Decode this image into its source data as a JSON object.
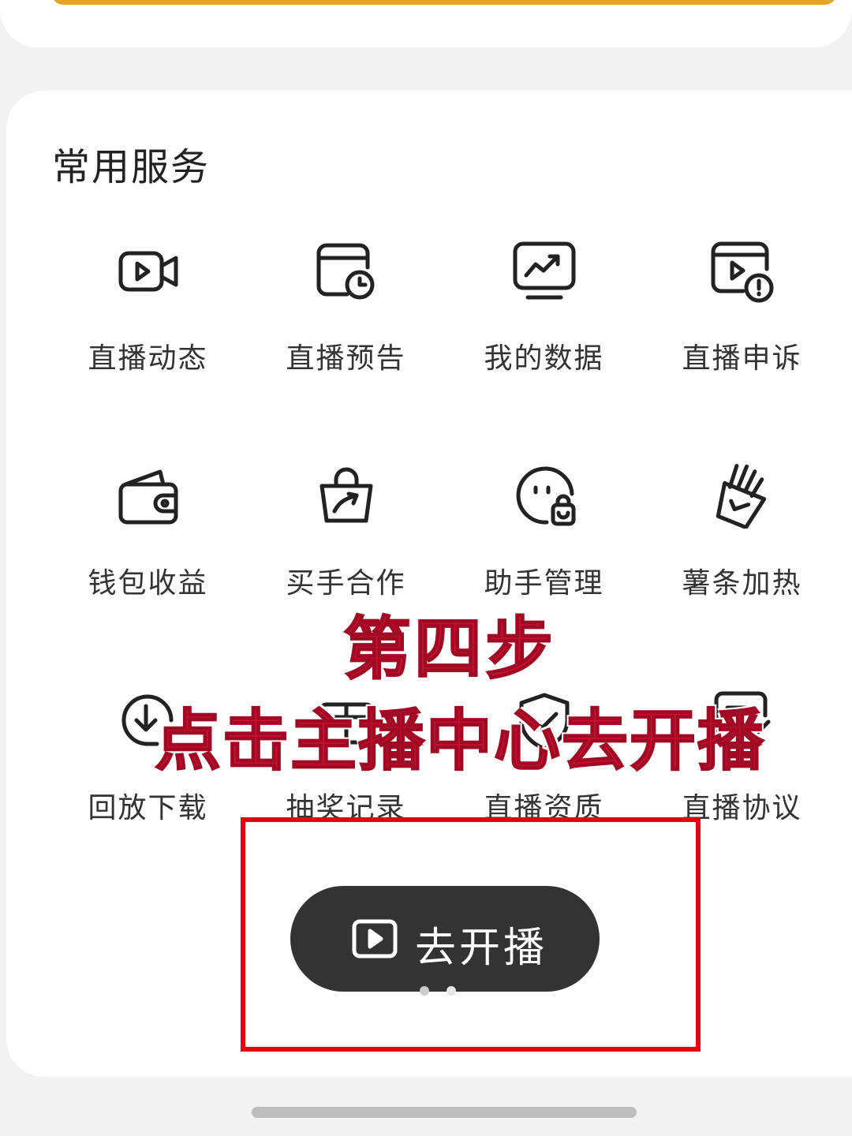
{
  "section": {
    "title": "常用服务"
  },
  "services": [
    {
      "label": "直播动态",
      "icon": "video-camera-icon"
    },
    {
      "label": "直播预告",
      "icon": "calendar-clock-icon"
    },
    {
      "label": "我的数据",
      "icon": "trend-chart-icon"
    },
    {
      "label": "直播申诉",
      "icon": "video-alert-icon"
    },
    {
      "label": "钱包收益",
      "icon": "wallet-icon"
    },
    {
      "label": "买手合作",
      "icon": "shopping-bag-arrow-icon"
    },
    {
      "label": "助手管理",
      "icon": "assistant-face-icon"
    },
    {
      "label": "薯条加热",
      "icon": "fries-boost-icon"
    },
    {
      "label": "回放下载",
      "icon": "download-icon"
    },
    {
      "label": "抽奖记录",
      "icon": "lottery-icon"
    },
    {
      "label": "直播资质",
      "icon": "qualification-icon"
    },
    {
      "label": "直播协议",
      "icon": "agreement-icon"
    }
  ],
  "overlay": {
    "step": "第四步",
    "instruction": "点击主播中心去开播"
  },
  "go_live_button": {
    "label": "去开播",
    "icon": "play-square-icon"
  },
  "pager": {
    "count": 2,
    "active_index": 0
  },
  "colors": {
    "overlay_text": "#c8102e",
    "highlight_box": "#e50010",
    "button_bg": "#333336",
    "accent_bar": "#e2a524"
  }
}
